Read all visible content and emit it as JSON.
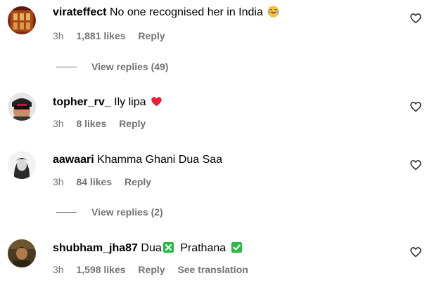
{
  "comments": [
    {
      "username": "virateffect",
      "text": "No one recognised her in India",
      "emoji": "laughing-tears-emoji",
      "time": "3h",
      "likes": "1,881 likes",
      "reply": "Reply",
      "view_replies": "View replies (49)"
    },
    {
      "username": "topher_rv_",
      "text": "Ily lipa",
      "emoji": "red-heart-emoji",
      "time": "3h",
      "likes": "8 likes",
      "reply": "Reply"
    },
    {
      "username": "aawaari",
      "text": "Khamma Ghani Dua Saa",
      "time": "3h",
      "likes": "84 likes",
      "reply": "Reply",
      "view_replies": "View replies (2)"
    },
    {
      "username": "shubham_jha87",
      "text_a": "Dua",
      "emoji_a": "cross-mark-button-emoji",
      "text_b": "Prathana",
      "emoji_b": "check-mark-button-emoji",
      "time": "3h",
      "likes": "1,598 likes",
      "reply": "Reply",
      "see_translation": "See translation"
    }
  ],
  "colors": {
    "text": "#000000",
    "meta": "#737373",
    "emoji_green": "#2db84c"
  }
}
